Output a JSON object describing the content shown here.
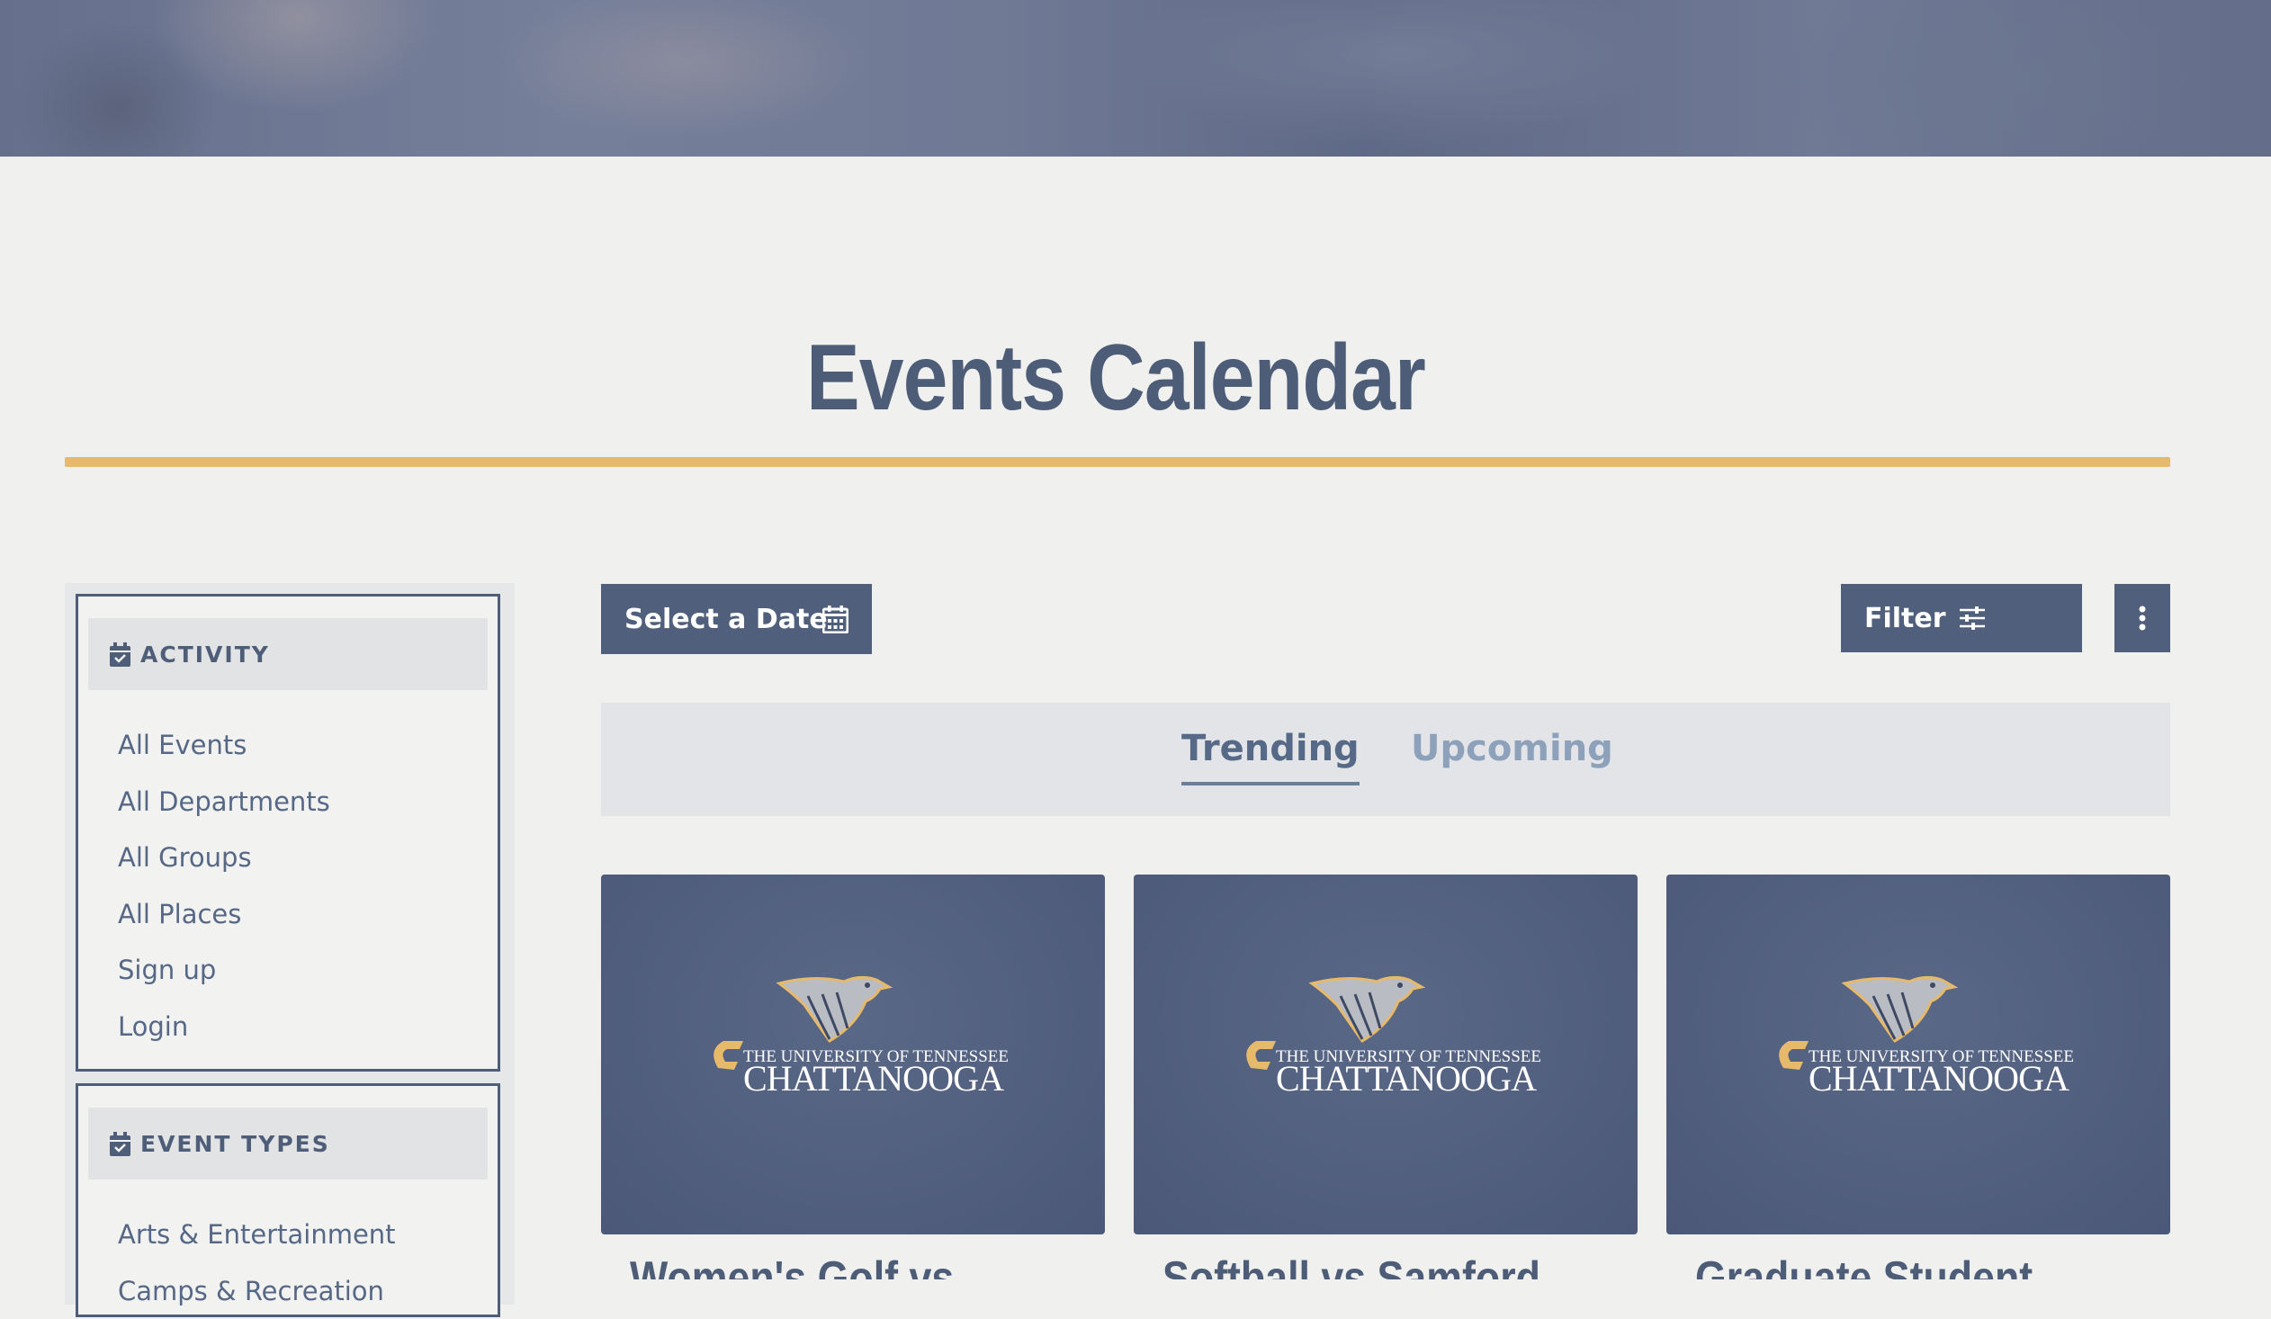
{
  "page": {
    "title": "Events Calendar"
  },
  "sidebar": {
    "activity": {
      "heading": "ACTIVITY",
      "items": [
        "All Events",
        "All Departments",
        "All Groups",
        "All Places",
        "Sign up",
        "Login"
      ]
    },
    "event_types": {
      "heading": "EVENT TYPES",
      "items": [
        "Arts & Entertainment",
        "Camps & Recreation"
      ]
    }
  },
  "toolbar": {
    "date_label": "Select a Date",
    "filter_label": "Filter"
  },
  "tabs": {
    "trending": "Trending",
    "upcoming": "Upcoming",
    "active": "Trending"
  },
  "events": [
    {
      "title": "Women's Golf vs"
    },
    {
      "title": "Softball vs Samford"
    },
    {
      "title": "Graduate Student"
    }
  ],
  "logo": {
    "line1": "THE UNIVERSITY OF TENNESSEE",
    "line2": "CHATTANOOGA"
  },
  "colors": {
    "accent_gold": "#e6b96b",
    "primary_slate": "#505f7b",
    "tab_inactive": "#8ea1ba"
  }
}
